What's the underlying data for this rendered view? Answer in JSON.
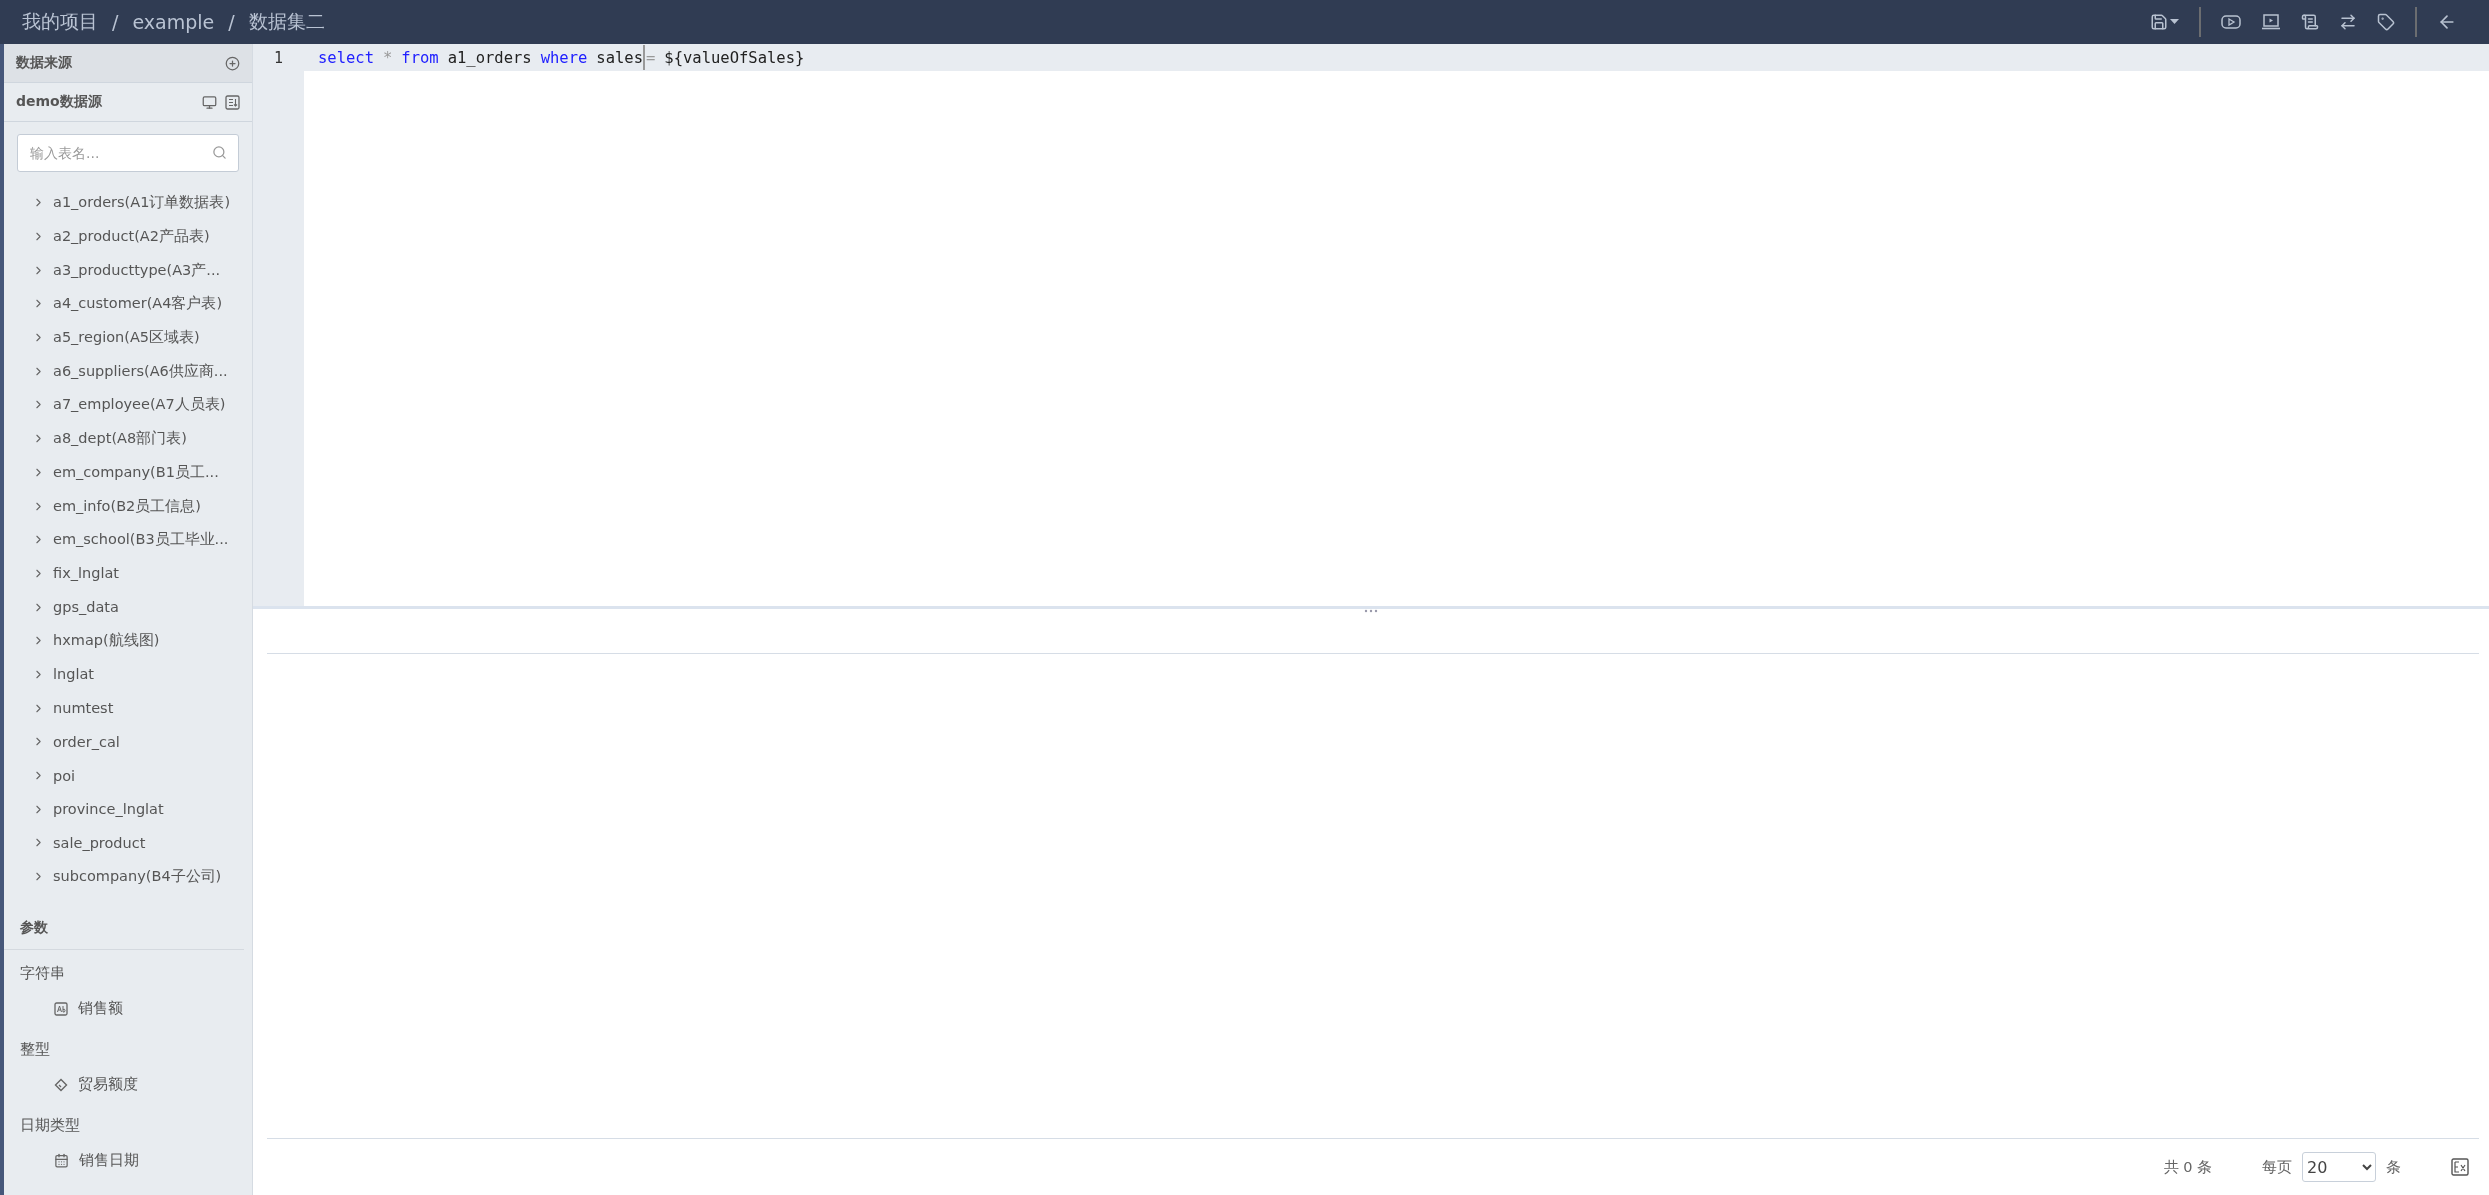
{
  "breadcrumb": [
    "我的项目",
    "example",
    "数据集二"
  ],
  "breadcrumb_separator": "/",
  "sidebar": {
    "title": "数据来源",
    "datasource": "demo数据源",
    "search": {
      "placeholder": "输入表名..."
    },
    "tables": [
      {
        "label": "a1_orders(A1订单数据表)",
        "expanded": false
      },
      {
        "label": "a2_product(A2产品表)",
        "expanded": false
      },
      {
        "label": "a3_producttype(A3产...",
        "expanded": false
      },
      {
        "label": "a4_customer(A4客户表)",
        "expanded": false
      },
      {
        "label": "a5_region(A5区域表)",
        "expanded": false
      },
      {
        "label": "a6_suppliers(A6供应商...",
        "expanded": false
      },
      {
        "label": "a7_employee(A7人员表)",
        "expanded": false
      },
      {
        "label": "a8_dept(A8部门表)",
        "expanded": false
      },
      {
        "label": "em_company(B1员工...",
        "expanded": false
      },
      {
        "label": "em_info(B2员工信息)",
        "expanded": false
      },
      {
        "label": "em_school(B3员工毕业...",
        "expanded": false
      },
      {
        "label": "fix_lnglat",
        "expanded": false
      },
      {
        "label": "gps_data",
        "expanded": false
      },
      {
        "label": "hxmap(航线图)",
        "expanded": false
      },
      {
        "label": "lnglat",
        "expanded": false
      },
      {
        "label": "numtest",
        "expanded": false
      },
      {
        "label": "order_cal",
        "expanded": false
      },
      {
        "label": "poi",
        "expanded": false
      },
      {
        "label": "province_lnglat",
        "expanded": false
      },
      {
        "label": "sale_product",
        "expanded": false
      },
      {
        "label": "subcompany(B4子公司)",
        "expanded": false
      }
    ],
    "params_title": "参数",
    "param_groups": [
      {
        "type": "字符串",
        "items": [
          {
            "kind": "string",
            "label": "销售额"
          }
        ]
      },
      {
        "type": "整型",
        "items": [
          {
            "kind": "integer",
            "label": "贸易额度"
          }
        ]
      },
      {
        "type": "日期类型",
        "items": [
          {
            "kind": "date",
            "label": "销售日期"
          }
        ]
      }
    ]
  },
  "editor": {
    "lines": [
      {
        "number": "1",
        "tokens": [
          {
            "kind": "keyword",
            "text": "select"
          },
          {
            "kind": "operator",
            "text": "*"
          },
          {
            "kind": "keyword",
            "text": "from"
          },
          {
            "kind": "text",
            "text": "a1_orders"
          },
          {
            "kind": "keyword",
            "text": "where"
          },
          {
            "kind": "text",
            "text": "sales"
          },
          {
            "kind": "cursor"
          },
          {
            "kind": "operator",
            "text": "="
          },
          {
            "kind": "text",
            "text": "${valueOfSales}"
          }
        ]
      }
    ]
  },
  "pagination": {
    "total": "共 0 条",
    "per_page_label": "每页",
    "per_page": "20",
    "unit": "条"
  }
}
